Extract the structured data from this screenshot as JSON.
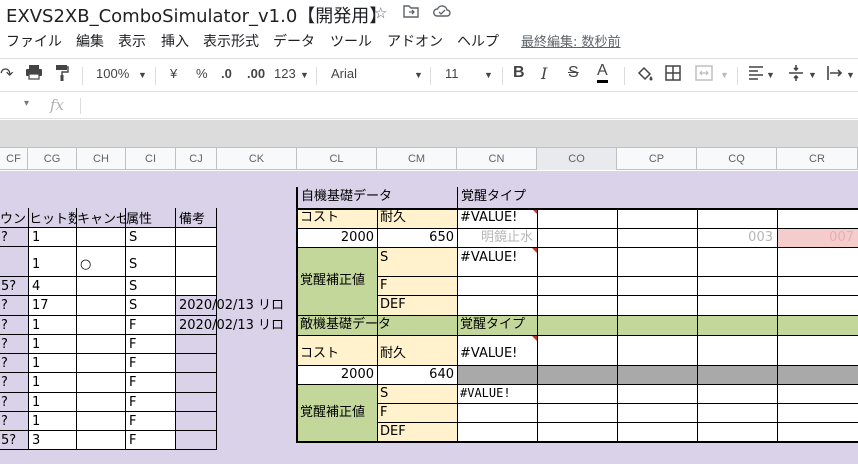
{
  "title": {
    "doc_title": "EXVS2XB_ComboSimulator_v1.0【開発用】",
    "star_icon": "star-icon",
    "move_icon": "folder-move-icon",
    "cloud_icon": "cloud-status-icon"
  },
  "menu": {
    "items": [
      "ファイル",
      "編集",
      "表示",
      "挿入",
      "表示形式",
      "データ",
      "ツール",
      "アドオン",
      "ヘルプ"
    ],
    "last_edit": "最終編集: 数秒前"
  },
  "toolbar": {
    "zoom": "100%",
    "currency": "¥",
    "percent": "%",
    "dec_decrease": ".0",
    "dec_increase": ".00",
    "more_formats": "123",
    "font": "Arial",
    "font_size": "11",
    "bold": "B",
    "italic": "I",
    "strike": "S",
    "text_color": "A"
  },
  "formula_bar": {
    "fx": "fx"
  },
  "columns": [
    "CF",
    "CG",
    "CH",
    "CI",
    "CJ",
    "CK",
    "CL",
    "CM",
    "CN",
    "CO",
    "CP",
    "CQ",
    "CR"
  ],
  "left_table": {
    "headers": [
      "ウン",
      "ヒット数",
      "キャンセ",
      "属性",
      "備考"
    ],
    "rows": [
      [
        "?",
        "1",
        "",
        "S",
        ""
      ],
      [
        "",
        "1",
        "○",
        "S",
        ""
      ],
      [
        "5?",
        "4",
        "",
        "S",
        ""
      ],
      [
        "?",
        "17",
        "",
        "S",
        "2020/02/13 リロ"
      ],
      [
        "?",
        "1",
        "",
        "F",
        "2020/02/13 リロ"
      ],
      [
        "?",
        "1",
        "",
        "F",
        ""
      ],
      [
        "?",
        "1",
        "",
        "F",
        ""
      ],
      [
        "?",
        "1",
        "",
        "F",
        ""
      ],
      [
        "?",
        "1",
        "",
        "F",
        ""
      ],
      [
        "?",
        "1",
        "",
        "F",
        ""
      ],
      [
        "5?",
        "3",
        "",
        "F",
        ""
      ]
    ]
  },
  "self_block": {
    "title": "自機基礎データ",
    "awake_type_label": "覚醒タイプ",
    "cost_label": "コスト",
    "durability_label": "耐久",
    "awake_type_value": "#VALUE!",
    "cost_value": "2000",
    "durability_value": "650",
    "mirror_text": "明鏡止水",
    "code_003": "003",
    "code_007": "007",
    "correction_label": "覚醒補正値",
    "s_label": "S",
    "f_label": "F",
    "def_label": "DEF",
    "s_value": "#VALUE!"
  },
  "enemy_block": {
    "title": "敵機基礎データ",
    "awake_type_label": "覚醒タイプ",
    "cost_label": "コスト",
    "durability_label": "耐久",
    "awake_type_value": "#VALUE!",
    "cost_value": "2000",
    "durability_value": "640",
    "correction_label": "覚醒補正値",
    "s_label": "S",
    "f_label": "F",
    "def_label": "DEF",
    "s_value": "#VALUE!"
  }
}
